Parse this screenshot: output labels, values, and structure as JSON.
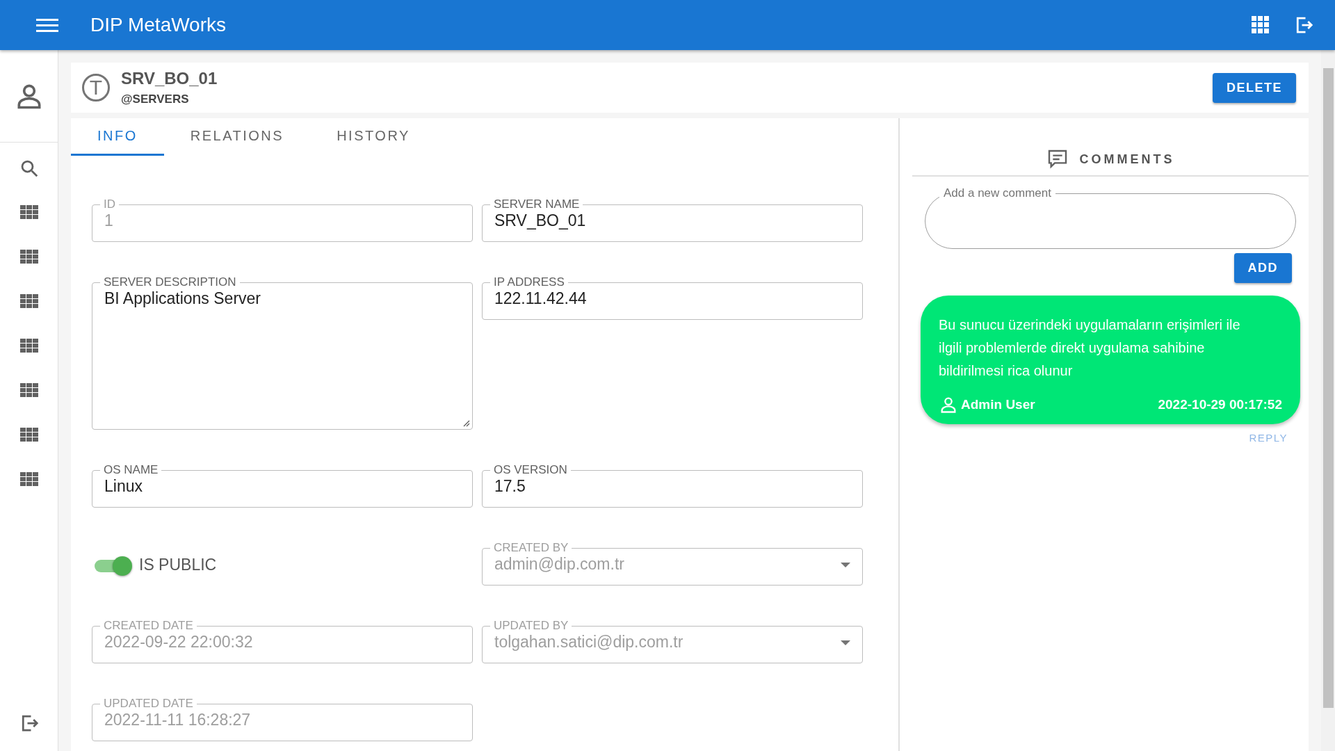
{
  "app_bar": {
    "title": "DIP MetaWorks"
  },
  "record": {
    "avatar_letter": "T",
    "name": "SRV_BO_01",
    "collection": "@SERVERS",
    "delete_button": "DELETE"
  },
  "tabs": [
    {
      "label": "INFO",
      "selected": true
    },
    {
      "label": "RELATIONS",
      "selected": false
    },
    {
      "label": "HISTORY",
      "selected": false
    }
  ],
  "fields": [
    {
      "kind": "text",
      "label": "ID",
      "value": "1",
      "disabled": true
    },
    {
      "kind": "text",
      "label": "SERVER NAME",
      "value": "SRV_BO_01",
      "disabled": false
    },
    {
      "kind": "textarea",
      "label": "SERVER DESCRIPTION",
      "value": "BI Applications Server",
      "disabled": false
    },
    {
      "kind": "text",
      "label": "IP ADDRESS",
      "value": "122.11.42.44",
      "disabled": false
    },
    {
      "kind": "text",
      "label": "OS NAME",
      "value": "Linux",
      "disabled": false
    },
    {
      "kind": "text",
      "label": "OS VERSION",
      "value": "17.5",
      "disabled": false
    },
    {
      "kind": "switch",
      "label": "IS PUBLIC",
      "on": true
    },
    {
      "kind": "select",
      "label": "CREATED BY",
      "value": "admin@dip.com.tr",
      "disabled": true
    },
    {
      "kind": "text",
      "label": "CREATED DATE",
      "value": "2022-09-22 22:00:32",
      "disabled": true
    },
    {
      "kind": "select",
      "label": "UPDATED BY",
      "value": "tolgahan.satici@dip.com.tr",
      "disabled": true
    },
    {
      "kind": "text",
      "label": "UPDATED DATE",
      "value": "2022-11-11 16:28:27",
      "disabled": true
    }
  ],
  "comments": {
    "title": "COMMENTS",
    "input_label": "Add a new comment",
    "add_button": "ADD",
    "items": [
      {
        "text": "Bu sunucu üzerindeki uygulamaların erişimleri ile ilgili problemlerde direkt uygulama sahibine bildirilmesi rica olunur",
        "author": "Admin User",
        "time": "2022-10-29 00:17:52",
        "reply": "REPLY"
      }
    ]
  }
}
